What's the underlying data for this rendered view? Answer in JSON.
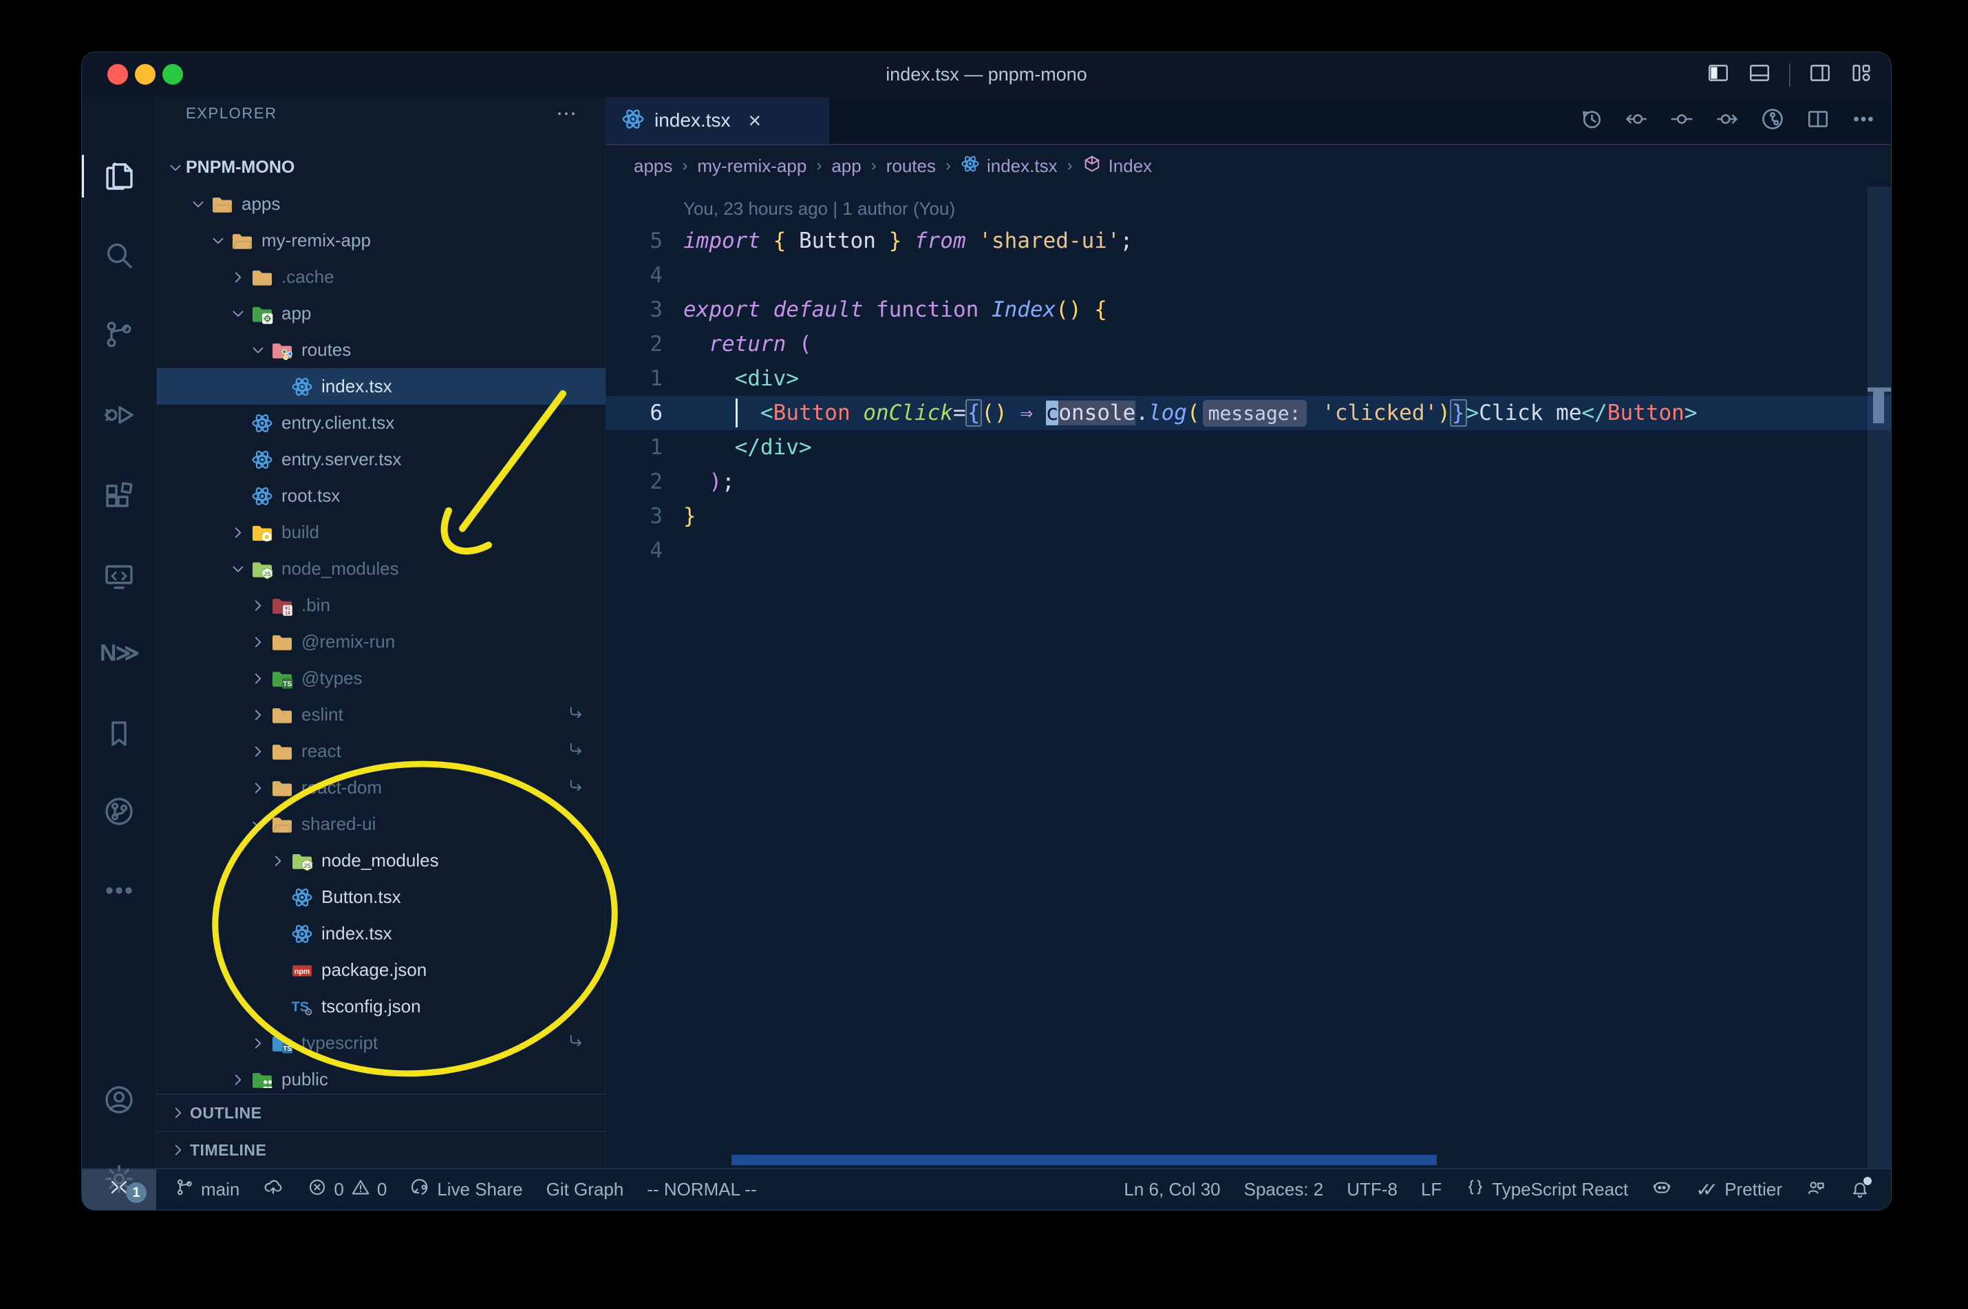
{
  "window": {
    "title": "index.tsx — pnpm-mono"
  },
  "titlebar": {
    "layout_icons": [
      "layout-sidebar-left",
      "layout-panel",
      "sep",
      "layout-sidebar-right",
      "layout-customize"
    ]
  },
  "activity_bar": {
    "items": [
      {
        "name": "explorer",
        "icon": "files",
        "active": true
      },
      {
        "name": "search",
        "icon": "search"
      },
      {
        "name": "source-control",
        "icon": "scm"
      },
      {
        "name": "run-debug",
        "icon": "debug"
      },
      {
        "name": "extensions",
        "icon": "extensions"
      },
      {
        "name": "remote-explorer",
        "icon": "remote"
      },
      {
        "name": "nx-console",
        "icon": "nx",
        "text": "N≫"
      },
      {
        "name": "bookmarks",
        "icon": "bookmark"
      },
      {
        "name": "git-graph",
        "icon": "gitgraph"
      },
      {
        "name": "more",
        "icon": "more"
      }
    ],
    "bottom": [
      {
        "name": "accounts",
        "icon": "account"
      },
      {
        "name": "settings",
        "icon": "gear",
        "badge": "1"
      }
    ]
  },
  "explorer": {
    "header": "EXPLORER",
    "header_actions": "⋯",
    "root": {
      "label": "PNPM-MONO"
    },
    "items": [
      {
        "label": "apps",
        "level": 1,
        "icon": "folder-open",
        "chevron": "down"
      },
      {
        "label": "my-remix-app",
        "level": 2,
        "icon": "folder-open",
        "chevron": "down"
      },
      {
        "label": ".cache",
        "level": 3,
        "icon": "folder",
        "chevron": "right",
        "dim": true
      },
      {
        "label": "app",
        "level": 3,
        "icon": "folder-app",
        "chevron": "down"
      },
      {
        "label": "routes",
        "level": 4,
        "icon": "folder-routes",
        "chevron": "down"
      },
      {
        "label": "index.tsx",
        "level": 5,
        "icon": "react",
        "selected": true
      },
      {
        "label": "entry.client.tsx",
        "level": 3,
        "icon": "react"
      },
      {
        "label": "entry.server.tsx",
        "level": 3,
        "icon": "react"
      },
      {
        "label": "root.tsx",
        "level": 3,
        "icon": "react"
      },
      {
        "label": "build",
        "level": 3,
        "icon": "folder-dist",
        "chevron": "right",
        "dim": true
      },
      {
        "label": "node_modules",
        "level": 3,
        "icon": "folder-node",
        "chevron": "down",
        "dim": true
      },
      {
        "label": ".bin",
        "level": 4,
        "icon": "folder-bin",
        "chevron": "right",
        "dim": true
      },
      {
        "label": "@remix-run",
        "level": 4,
        "icon": "folder",
        "chevron": "right",
        "dim": true
      },
      {
        "label": "@types",
        "level": 4,
        "icon": "folder-types",
        "chevron": "right",
        "dim": true
      },
      {
        "label": "eslint",
        "level": 4,
        "icon": "folder",
        "chevron": "right",
        "dim": true,
        "symlink": true
      },
      {
        "label": "react",
        "level": 4,
        "icon": "folder",
        "chevron": "right",
        "dim": true,
        "symlink": true
      },
      {
        "label": "react-dom",
        "level": 4,
        "icon": "folder",
        "chevron": "right",
        "dim": true,
        "symlink": true
      },
      {
        "label": "shared-ui",
        "level": 4,
        "icon": "folder-open",
        "chevron": "down",
        "dim": true,
        "symlink": true
      },
      {
        "label": "node_modules",
        "level": 5,
        "icon": "folder-node",
        "chevron": "right",
        "bright": true
      },
      {
        "label": "Button.tsx",
        "level": 5,
        "icon": "react",
        "bright": true
      },
      {
        "label": "index.tsx",
        "level": 5,
        "icon": "react",
        "bright": true
      },
      {
        "label": "package.json",
        "level": 5,
        "icon": "npm",
        "bright": true
      },
      {
        "label": "tsconfig.json",
        "level": 5,
        "icon": "tsconfig",
        "bright": true
      },
      {
        "label": "typescript",
        "level": 4,
        "icon": "folder-ts",
        "chevron": "right",
        "dim": true,
        "symlink": true
      },
      {
        "label": "public",
        "level": 3,
        "icon": "folder-public",
        "chevron": "right"
      }
    ],
    "sections": [
      {
        "label": "OUTLINE"
      },
      {
        "label": "TIMELINE"
      }
    ]
  },
  "editor": {
    "tab": {
      "label": "index.tsx",
      "close": "×"
    },
    "actions": [
      "history",
      "commit-prev",
      "commit",
      "commit-next",
      "branch-circle",
      "split",
      "ellipsis"
    ],
    "breadcrumbs": [
      {
        "label": "apps"
      },
      {
        "label": "my-remix-app"
      },
      {
        "label": "app"
      },
      {
        "label": "routes"
      },
      {
        "label": "index.tsx",
        "icon": "react"
      },
      {
        "label": "Index",
        "icon": "symbol"
      }
    ],
    "blame": "You, 23 hours ago | 1 author (You)",
    "lines": [
      {
        "n": "5",
        "s": [
          [
            "import",
            "kw"
          ],
          [
            " ",
            "w"
          ],
          [
            "{",
            "y"
          ],
          [
            " Button ",
            "w"
          ],
          [
            "}",
            "y"
          ],
          [
            " ",
            "w"
          ],
          [
            "from",
            "kw"
          ],
          [
            " ",
            "w"
          ],
          [
            "'shared-ui'",
            "str"
          ],
          [
            ";",
            "w"
          ]
        ]
      },
      {
        "n": "4",
        "s": []
      },
      {
        "n": "3",
        "s": [
          [
            "export",
            "kw"
          ],
          [
            " ",
            "w"
          ],
          [
            "default",
            "kw"
          ],
          [
            " ",
            "w"
          ],
          [
            "function",
            "kwu"
          ],
          [
            " ",
            "w"
          ],
          [
            "Index",
            "fn"
          ],
          [
            "()",
            "y"
          ],
          [
            " ",
            "w"
          ],
          [
            "{",
            "y"
          ]
        ]
      },
      {
        "n": "2",
        "s": [
          [
            "  ",
            "w"
          ],
          [
            "return",
            "kw"
          ],
          [
            " ",
            "w"
          ],
          [
            "(",
            "pink"
          ]
        ]
      },
      {
        "n": "1",
        "s": [
          [
            "    ",
            "w"
          ],
          [
            "<div>",
            "tag"
          ]
        ]
      },
      {
        "n": "6",
        "cur": true,
        "s": [
          [
            "      ",
            "w"
          ],
          [
            "<",
            "tag"
          ],
          [
            "Button",
            "comp"
          ],
          [
            " ",
            "w"
          ],
          [
            "onClick",
            "attr"
          ],
          [
            "=",
            "w"
          ],
          [
            "{",
            "blue bm"
          ],
          [
            "()",
            "y"
          ],
          [
            " ",
            "w"
          ],
          [
            "⇒",
            "pink"
          ],
          [
            " ",
            "w"
          ],
          [
            "c",
            "w cursor"
          ],
          [
            "onsole",
            "w occ"
          ],
          [
            ".",
            "w"
          ],
          [
            "log",
            "fn"
          ],
          [
            "(",
            "y"
          ],
          [
            "message:",
            "inlay"
          ],
          [
            " ",
            "w"
          ],
          [
            "'clicked'",
            "str"
          ],
          [
            ")",
            "y"
          ],
          [
            "}",
            "blue bm"
          ],
          [
            ">",
            "tag"
          ],
          [
            "Click me",
            "w"
          ],
          [
            "</",
            "tag"
          ],
          [
            "Button",
            "comp"
          ],
          [
            ">",
            "tag"
          ]
        ]
      },
      {
        "n": "1",
        "s": [
          [
            "    ",
            "w"
          ],
          [
            "</div>",
            "tag"
          ]
        ]
      },
      {
        "n": "2",
        "s": [
          [
            "  ",
            "w"
          ],
          [
            ")",
            "pink"
          ],
          [
            ";",
            "w"
          ]
        ]
      },
      {
        "n": "3",
        "s": [
          [
            "}",
            "y"
          ]
        ]
      },
      {
        "n": "4",
        "s": []
      }
    ]
  },
  "status_bar": {
    "left": [
      {
        "icon": "branch",
        "label": "main",
        "name": "branch-main"
      },
      {
        "icon": "sync",
        "label": "",
        "name": "sync"
      },
      {
        "icon": "error",
        "label": "0",
        "icon2": "warning",
        "label2": "0",
        "name": "problems"
      },
      {
        "icon": "liveshare",
        "label": "Live Share",
        "name": "live-share"
      },
      {
        "label": "Git Graph",
        "name": "git-graph"
      },
      {
        "label": "-- NORMAL --",
        "name": "vim-mode"
      }
    ],
    "right": [
      {
        "label": "Ln 6, Col 30",
        "name": "cursor-position"
      },
      {
        "label": "Spaces: 2",
        "name": "indentation"
      },
      {
        "label": "UTF-8",
        "name": "encoding"
      },
      {
        "label": "LF",
        "name": "eol"
      },
      {
        "icon": "braces",
        "label": "TypeScript React",
        "name": "language-mode"
      },
      {
        "icon": "copilot",
        "label": "",
        "name": "copilot"
      },
      {
        "icon": "prettier-check",
        "label": "Prettier",
        "name": "prettier"
      },
      {
        "icon": "feedback",
        "label": "",
        "name": "feedback"
      },
      {
        "icon": "bell",
        "label": "",
        "name": "notifications",
        "badge": true
      }
    ]
  },
  "colors": {
    "yellow_annotation": "#f2e31c",
    "accent_selection": "#1c3a5e",
    "keyword": "#c792ea",
    "string": "#ecc48d",
    "tag": "#7fdbca",
    "component": "#fc7b70",
    "traffic_red": "#ff5f57",
    "traffic_yellow": "#febc2e",
    "traffic_green": "#28c840"
  }
}
